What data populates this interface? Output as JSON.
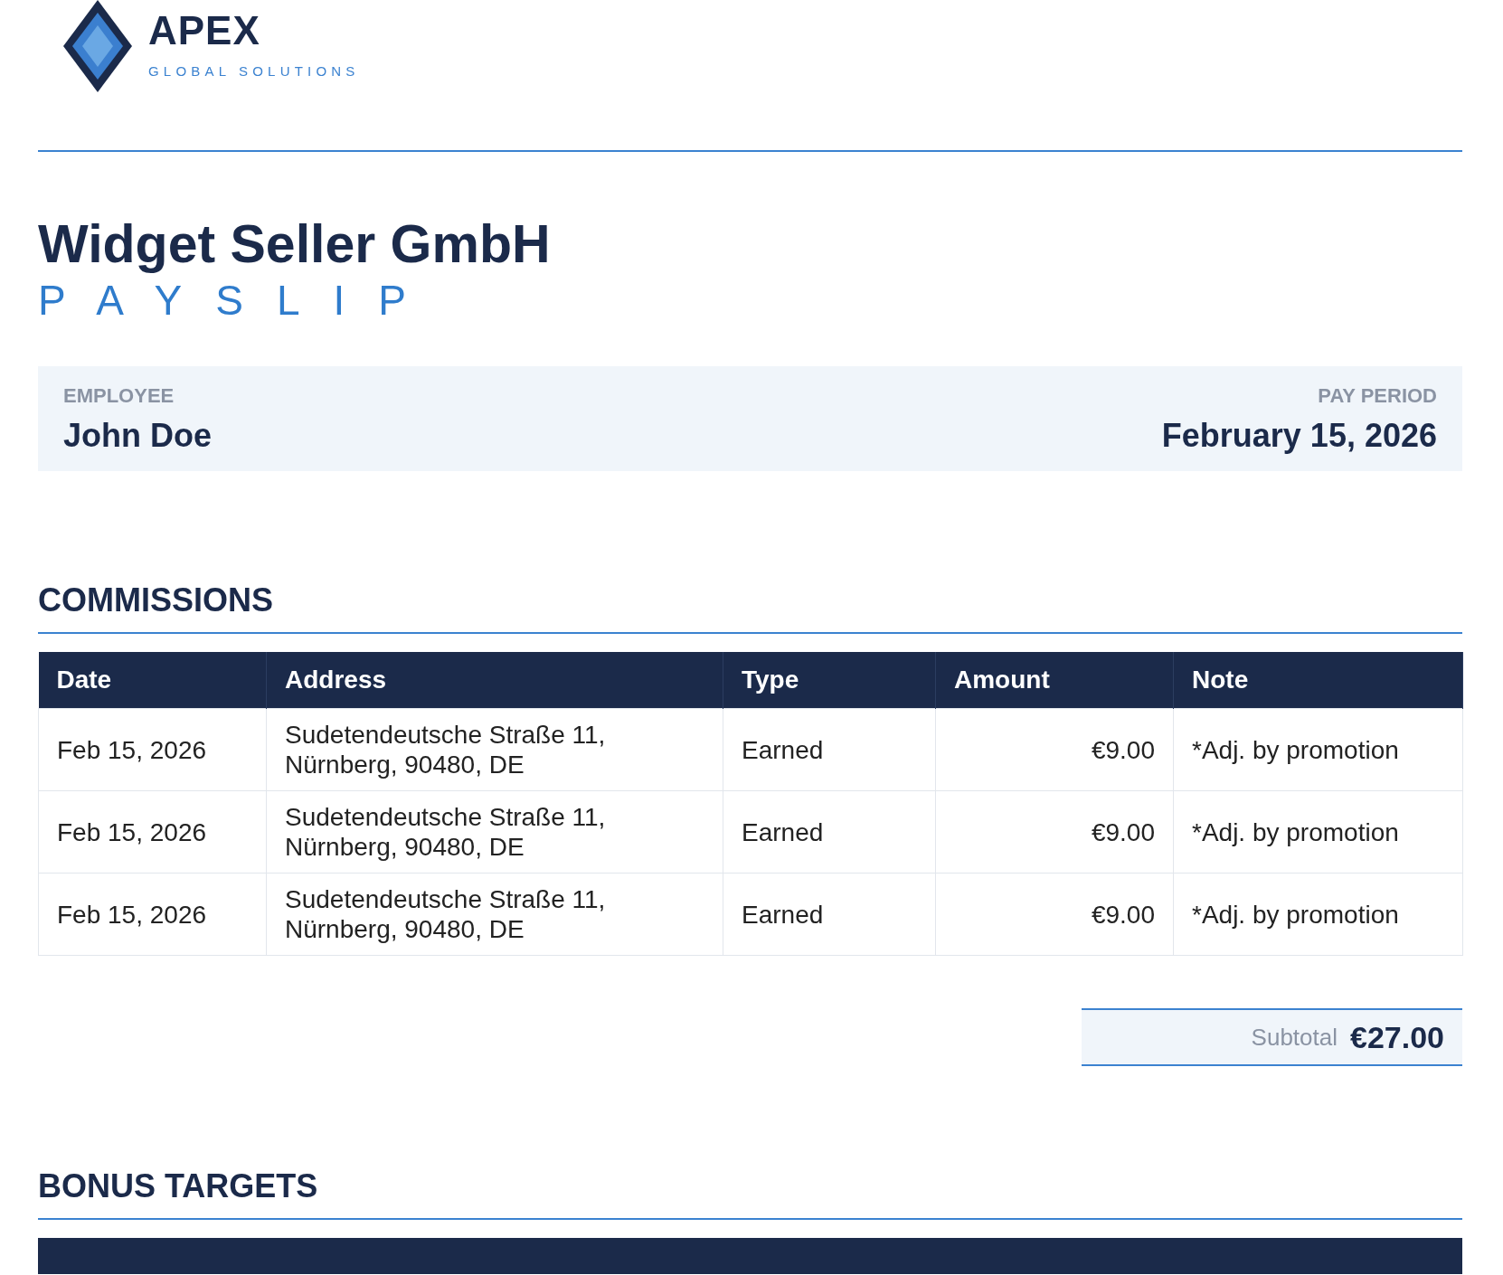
{
  "logo": {
    "name": "APEX",
    "tagline": "GLOBAL SOLUTIONS"
  },
  "company": "Widget Seller GmbH",
  "document_type": "PAYSLIP",
  "employee": {
    "label": "EMPLOYEE",
    "name": "John Doe"
  },
  "pay_period": {
    "label": "PAY PERIOD",
    "date": "February 15, 2026"
  },
  "commissions": {
    "title": "COMMISSIONS",
    "columns": [
      "Date",
      "Address",
      "Type",
      "Amount",
      "Note"
    ],
    "rows": [
      {
        "date": "Feb 15, 2026",
        "address": "Sudetendeutsche Straße 11, Nürnberg, 90480, DE",
        "type": "Earned",
        "amount": "€9.00",
        "note": "*Adj. by promotion"
      },
      {
        "date": "Feb 15, 2026",
        "address": "Sudetendeutsche Straße 11, Nürnberg, 90480, DE",
        "type": "Earned",
        "amount": "€9.00",
        "note": "*Adj. by promotion"
      },
      {
        "date": "Feb 15, 2026",
        "address": "Sudetendeutsche Straße 11, Nürnberg, 90480, DE",
        "type": "Earned",
        "amount": "€9.00",
        "note": "*Adj. by promotion"
      }
    ],
    "subtotal": {
      "label": "Subtotal",
      "value": "€27.00"
    }
  },
  "bonus_targets": {
    "title": "BONUS TARGETS"
  }
}
